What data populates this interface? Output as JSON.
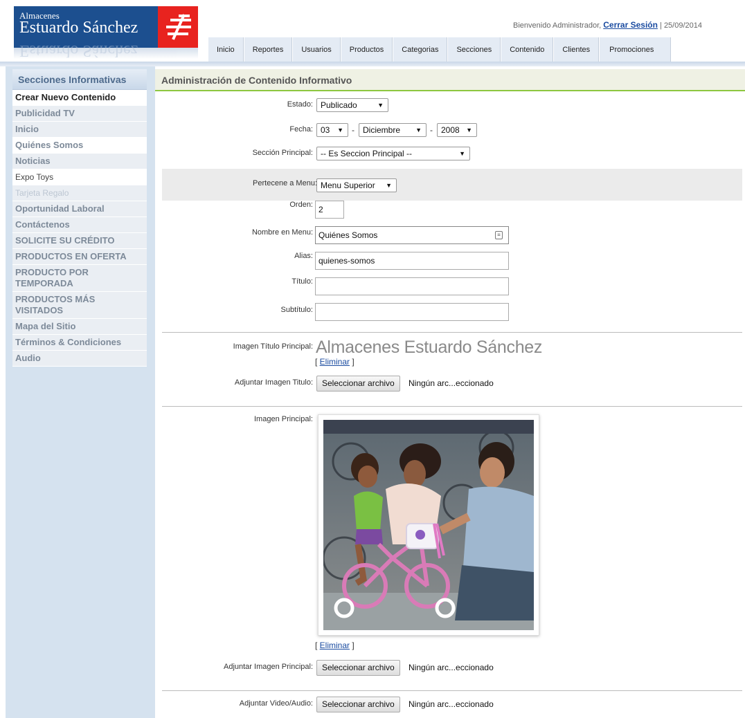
{
  "logo": {
    "line1": "Almacenes",
    "line2": "Estuardo Sánchez"
  },
  "userbar": {
    "welcome": "Bienvenido Administrador,",
    "logout": "Cerrar Sesión",
    "separator": "|",
    "date": "25/09/2014"
  },
  "topnav": [
    "Inicio",
    "Reportes",
    "Usuarios",
    "Productos",
    "Categorias",
    "Secciones",
    "Contenido",
    "Clientes",
    "Promociones"
  ],
  "sidebar": {
    "title": "Secciones Informativas",
    "items": [
      "Crear Nuevo Contenido",
      "Publicidad TV",
      "Inicio",
      "Quiénes Somos",
      "Noticias",
      "Expo Toys",
      "Tarjeta Regalo",
      "Oportunidad Laboral",
      "Contáctenos",
      "SOLICITE SU CRÉDITO",
      "PRODUCTOS EN OFERTA",
      "PRODUCTO POR TEMPORADA",
      "PRODUCTOS MÁS VISITADOS",
      "Mapa del Sitio",
      "Términos & Condiciones",
      "Audio"
    ]
  },
  "main": {
    "title": "Administración de Contenido Informativo",
    "estado": {
      "label": "Estado:",
      "value": "Publicado"
    },
    "fecha": {
      "label": "Fecha:",
      "day": "03",
      "month": "Diciembre",
      "year": "2008",
      "sep": "-"
    },
    "seccion": {
      "label": "Sección Principal:",
      "value": "-- Es Seccion Principal --"
    },
    "menu": {
      "label": "Pertecene a Menu:",
      "value": "Menu Superior"
    },
    "orden": {
      "label": "Orden:",
      "value": "2"
    },
    "nombre": {
      "label": "Nombre en Menu:",
      "value": "Quiénes Somos"
    },
    "alias": {
      "label": "Alias:",
      "value": "quienes-somos"
    },
    "titulo": {
      "label": "Título:",
      "value": ""
    },
    "subtitulo": {
      "label": "Subtítulo:",
      "value": ""
    },
    "imagen_titulo": {
      "label": "Imagen Título Principal:",
      "text": "Almacenes Estuardo Sánchez",
      "delete": "Eliminar"
    },
    "adjuntar_titulo": {
      "label": "Adjuntar Imagen Titulo:",
      "button": "Seleccionar archivo",
      "file": "Ningún arc...eccionado"
    },
    "imagen_principal": {
      "label": "Imagen Principal:",
      "delete": "Eliminar"
    },
    "adjuntar_principal": {
      "label": "Adjuntar Imagen Principal:",
      "button": "Seleccionar archivo",
      "file": "Ningún arc...eccionado"
    },
    "adjuntar_video": {
      "label": "Adjuntar Video/Audio:",
      "button": "Seleccionar archivo",
      "file": "Ningún arc...eccionado"
    }
  },
  "colors": {
    "brand_blue": "#1c4f8f",
    "brand_red": "#e8231f",
    "accent_green": "#8dc63f",
    "link": "#1a4ba0"
  }
}
